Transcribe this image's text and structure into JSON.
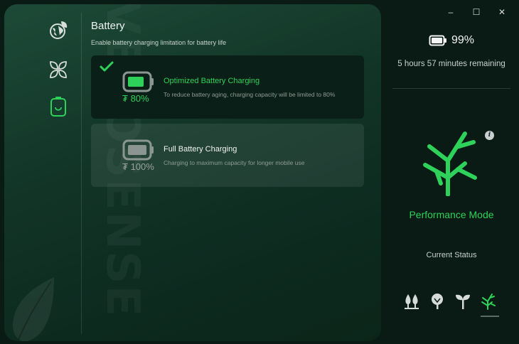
{
  "brand": {
    "watermark": "VEROSENSE"
  },
  "nav": {
    "items": [
      {
        "name": "eco",
        "icon": "globe-leaf-icon"
      },
      {
        "name": "wellness",
        "icon": "leaves-icon"
      },
      {
        "name": "battery",
        "icon": "battery-icon",
        "active": true
      }
    ]
  },
  "page": {
    "title": "Battery",
    "subtitle": "Enable battery charging limitation for battery life"
  },
  "options": [
    {
      "title": "Optimized Battery Charging",
      "description": "To reduce battery aging, charging capacity will be limited to 80%",
      "percent_text": "80%",
      "selected": true
    },
    {
      "title": "Full Battery Charging",
      "description": "Charging to maximum capacity for longer mobile use",
      "percent_text": "100%",
      "selected": false
    }
  ],
  "window_controls": {
    "minimize": "–",
    "maximize": "☐",
    "close": "✕"
  },
  "status": {
    "battery_level": "99%",
    "remaining": "5 hours 57 minutes remaining",
    "mode_name": "Performance Mode",
    "current_status_label": "Current Status",
    "modes": [
      {
        "icon": "trees-icon"
      },
      {
        "icon": "tree-icon"
      },
      {
        "icon": "sprout-icon"
      },
      {
        "icon": "performance-branch-icon",
        "active": true
      }
    ]
  },
  "colors": {
    "accent": "#2ed25a",
    "panel_dark": "#0a1f17",
    "text_primary": "#f1f4f2",
    "text_muted": "#8f9c96"
  }
}
